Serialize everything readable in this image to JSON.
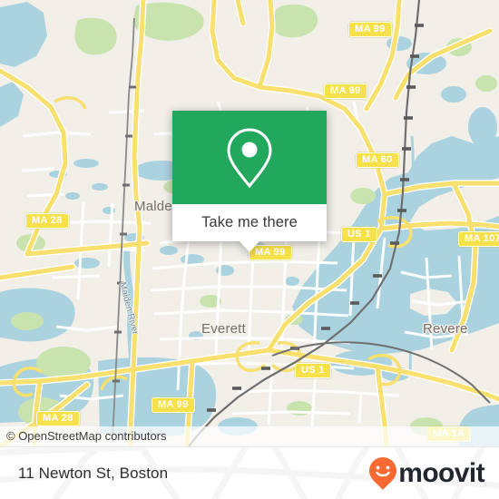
{
  "map": {
    "provider_attribution": "© OpenStreetMap contributors",
    "colors": {
      "land": "#f2efe9",
      "water": "#aad3df",
      "park": "#c9e3af",
      "road_major": "#f7e06e",
      "road_minor": "#ffffff",
      "rail": "#6f6f6f",
      "label": "#777068"
    },
    "place_labels": [
      {
        "name": "Malden",
        "text": "Malde"
      },
      {
        "name": "Everett",
        "text": "Everett"
      },
      {
        "name": "Revere",
        "text": "Revere"
      }
    ],
    "water_labels": [
      {
        "name": "Malden River",
        "text": "Malden River"
      }
    ],
    "road_shields": [
      {
        "text": "MA 99"
      },
      {
        "text": "MA 99"
      },
      {
        "text": "MA 60"
      },
      {
        "text": "MA 99"
      },
      {
        "text": "US 1"
      },
      {
        "text": "MA 107"
      },
      {
        "text": "MA 28"
      },
      {
        "text": "US 1"
      },
      {
        "text": "MA 99"
      },
      {
        "text": "MA 28"
      },
      {
        "text": "MA 1A"
      }
    ]
  },
  "callout": {
    "icon": "map-pin-icon",
    "accent_color": "#22a85c",
    "button_label": "Take me there"
  },
  "footer": {
    "address": "11 Newton St, Boston",
    "brand": "moovit",
    "brand_icon": "moovit-smiley-pin-icon",
    "brand_icon_color": "#f96a32",
    "brand_text_color": "#24272b"
  }
}
